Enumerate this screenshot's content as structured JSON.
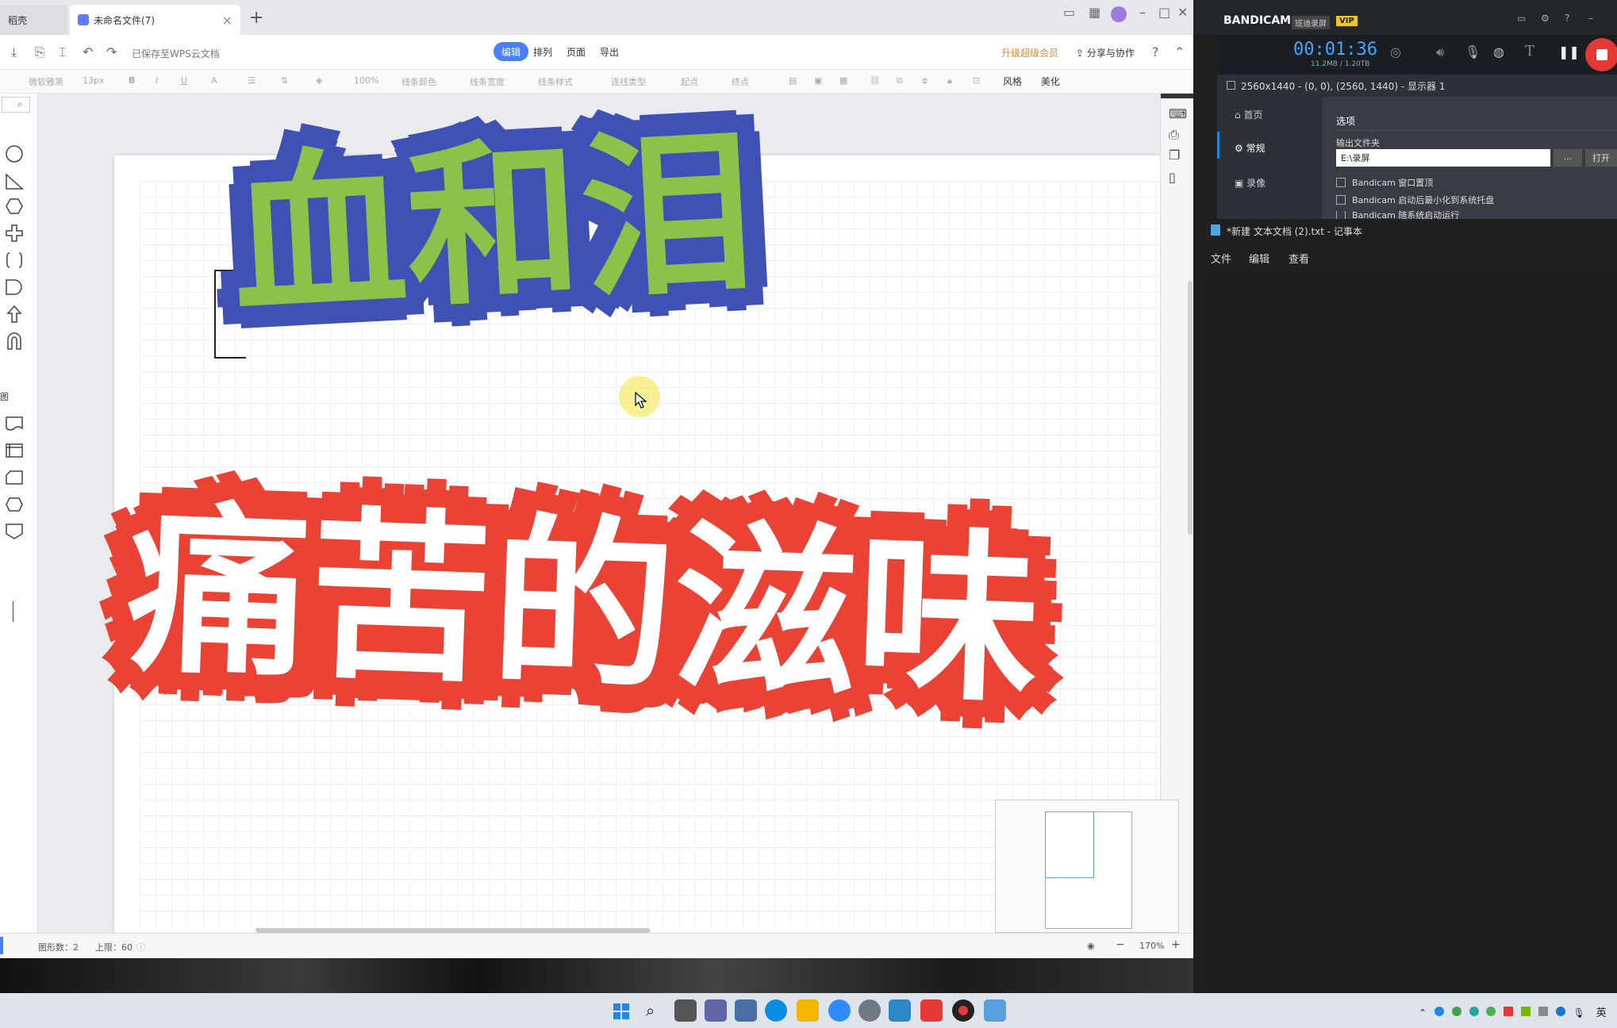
{
  "wps": {
    "tabs": [
      {
        "label": "稻壳"
      },
      {
        "label": "未命名文件(7)"
      }
    ],
    "menu": {
      "saved_status": "已保存至WPS云文档",
      "tabs": [
        "编辑",
        "排列",
        "页面",
        "导出"
      ],
      "upgrade": "升级超级会员",
      "share": "分享与协作"
    },
    "format_bar": {
      "font": "微软雅黑",
      "size": "13px",
      "zoom_field": "100%",
      "line_color": "线条颜色",
      "line_width": "线条宽度",
      "line_style": "线条样式",
      "conn_type": "连线类型",
      "start": "起点",
      "end": "终点",
      "style": "风格",
      "beautify": "美化"
    },
    "canvas": {
      "title_top": "血和泪",
      "title_bottom": "痛苦的滋味"
    },
    "status": {
      "shape_count": "图形数：2",
      "limit": "上限：60",
      "zoom": "170%"
    },
    "shapes_section": "图"
  },
  "bandicam": {
    "brand": "BANDICAM",
    "brand_sub": "班迪录屏",
    "vip": "VIP",
    "timer": "00:01:36",
    "size": "11.2MB / 1.20TB",
    "screen_info": "2560x1440 - (0, 0), (2560, 1440) - 显示器 1",
    "nav": [
      "首页",
      "常规",
      "录像"
    ],
    "options_title": "选项",
    "output_folder_label": "输出文件夹",
    "output_folder_value": "E:\\录屏",
    "browse": "...",
    "open": "打开",
    "checks": [
      "Bandicam 窗口置顶",
      "Bandicam 启动后最小化到系统托盘",
      "Bandicam 随系统启动运行"
    ]
  },
  "notepad": {
    "title": "*新建 文本文档 (2).txt - 记事本",
    "menu": [
      "文件",
      "编辑",
      "查看"
    ]
  },
  "taskbar": {
    "lang": "英"
  },
  "colors": {
    "title_top_fill": "#8bc34a",
    "title_top_stroke": "#3f51b5",
    "title_bottom_fill": "#ffffff",
    "title_bottom_stroke": "#ea4335",
    "wps_accent": "#4a80f6",
    "bandicam_blue": "#1e88e5",
    "record_red": "#e53935"
  }
}
